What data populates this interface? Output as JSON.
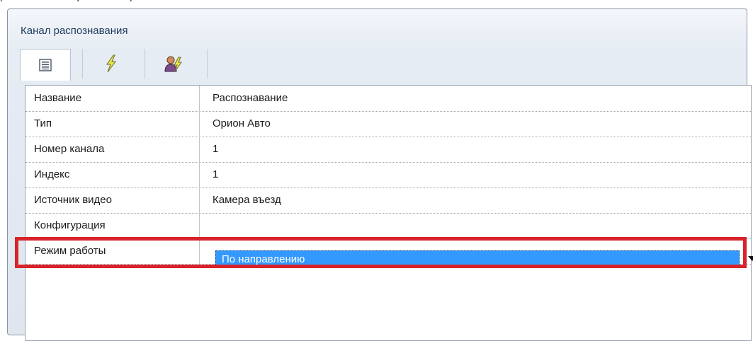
{
  "caption": "работы \"По направлению\")",
  "panel": {
    "title": "Канал распознавания"
  },
  "toolbar": {
    "buttons": [
      {
        "icon": "property-list-icon",
        "active": true
      },
      {
        "icon": "lightning-events-icon",
        "active": false
      },
      {
        "icon": "users-permissions-icon",
        "active": false
      }
    ]
  },
  "properties": [
    {
      "name": "Название",
      "value": "Распознавание"
    },
    {
      "name": "Тип",
      "value": "Орион Авто"
    },
    {
      "name": "Номер канала",
      "value": "1"
    },
    {
      "name": "Индекс",
      "value": "1"
    },
    {
      "name": "Источник видео",
      "value": "Камера въезд"
    },
    {
      "name": "Конфигурация",
      "value": ""
    },
    {
      "name": "Режим работы",
      "value": "По направлению"
    }
  ],
  "colors": {
    "highlight": "#d8232a",
    "selection": "#3399ff"
  }
}
